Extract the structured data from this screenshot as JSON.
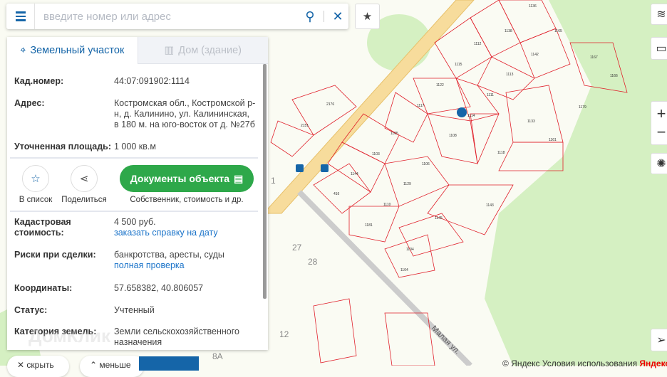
{
  "search": {
    "placeholder": "введите номер или адрес"
  },
  "tabs": [
    {
      "label": "Земельный участок"
    },
    {
      "label": "Дом (здание)"
    }
  ],
  "info": {
    "cad_label": "Кад.номер:",
    "cad_value": "44:07:091902:1114",
    "addr_label": "Адрес:",
    "addr_value": "Костромская обл., Костромской р-н, д. Калинино, ул. Калининская, в 180 м. на юго-восток от д. №27б",
    "area_label": "Уточненная площадь:",
    "area_value": "1 000 кв.м",
    "cost_label": "Кадастровая стоимость:",
    "cost_value": "4 500 руб.",
    "cost_link": "заказать справку на дату",
    "risk_label": "Риски при сделки:",
    "risk_value": "банкротства, аресты, суды",
    "risk_link": "полная проверка",
    "coord_label": "Координаты:",
    "coord_value": "57.658382, 40.806057",
    "status_label": "Статус:",
    "status_value": "Учтенный",
    "cat_label": "Категория земель:",
    "cat_value": "Земли сельскохозяйственного назначения"
  },
  "actions": {
    "fav": "В список",
    "share": "Поделиться",
    "docs": "Документы объекта",
    "docs_sub": "Собственник, стоимость и др."
  },
  "bottom": {
    "hide": "скрыть",
    "less": "меньше",
    "watermark": "ДомКлик"
  },
  "footer": {
    "copyright": "© Яндекс",
    "terms": "Условия использования",
    "brand": "Яндекс"
  },
  "map": {
    "street": "Малая ул.",
    "parcels": [
      "1136",
      "1138",
      "1165",
      "1112",
      "1142",
      "1115",
      "1113",
      "1167",
      "1166",
      "1122",
      "1111",
      "1117",
      "1114",
      "1179",
      "1108",
      "1133",
      "1105",
      "1161",
      "1118",
      "2176",
      "2151",
      "1103",
      "1106",
      "1144",
      "1129",
      "416",
      "1110",
      "1143",
      "1181",
      "1145",
      "1104",
      "1104"
    ],
    "houses": [
      "1",
      "27",
      "28",
      "12",
      "8А"
    ]
  },
  "colors": {
    "accent": "#1565a8",
    "green": "#2ea84a",
    "parcel": "#e0202a",
    "forest": "#d5f0c2"
  }
}
